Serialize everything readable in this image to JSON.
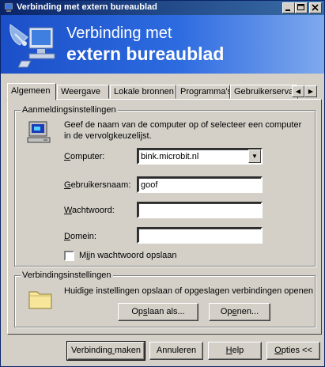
{
  "window": {
    "title": "Verbinding met extern bureaublad"
  },
  "banner": {
    "line1": "Verbinding met",
    "line2": "extern bureaublad"
  },
  "tabs": [
    {
      "label": "Algemeen"
    },
    {
      "label": "Weergave"
    },
    {
      "label": "Lokale bronnen"
    },
    {
      "label": "Programma's"
    },
    {
      "label": "Gebruikerservaring"
    }
  ],
  "login": {
    "legend": "Aanmeldingsinstellingen",
    "description": "Geef de naam van de computer op of selecteer een computer in de vervolgkeuzelijst.",
    "computer_label": "Computer:",
    "computer_value": "bink.microbit.nl",
    "username_label": "Gebruikersnaam:",
    "username_value": "goof",
    "password_label": "Wachtwoord:",
    "password_value": "",
    "domain_label": "Domein:",
    "domain_value": "",
    "save_password_label": "Mijn wachtwoord opslaan",
    "save_password_checked": false
  },
  "connection": {
    "legend": "Verbindingsinstellingen",
    "description": "Huidige instellingen opslaan of opgeslagen verbindingen openen",
    "save_as": "Opslaan als...",
    "open": "Openen..."
  },
  "footer": {
    "connect": "Verbinding maken",
    "cancel": "Annuleren",
    "help": "Help",
    "options": "Opties <<"
  }
}
